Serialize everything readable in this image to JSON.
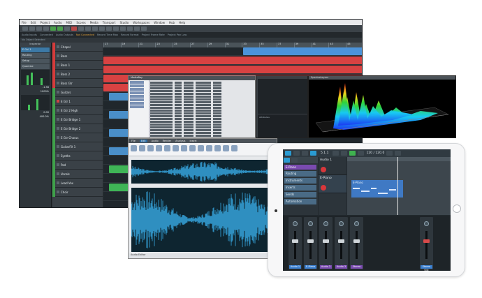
{
  "daw": {
    "menu": [
      "File",
      "Edit",
      "Project",
      "Audio",
      "MIDI",
      "Scores",
      "Media",
      "Transport",
      "Studio",
      "Workspaces",
      "Window",
      "Hub",
      "Help"
    ],
    "status": {
      "audio_inputs": "Audio Inputs",
      "connected": "Connected",
      "audio_outputs": "Audio Outputs",
      "not_connected": "Not Connected",
      "record_time": "Record Time Max",
      "record_format": "Record Format",
      "frame_rate": "Project Frame Rate",
      "pan_law": "Project Pan Law"
    },
    "info_line": "No Object Selected",
    "inspector_title": "Inspector",
    "inspector_rows": [
      "E Gui 1",
      "Routing",
      "Setup",
      "Quantize"
    ],
    "inspector_values": [
      "-1.58",
      "1000%",
      "0.00",
      "400.0%"
    ],
    "tracks": [
      {
        "name": "Chapel",
        "color": "#d43b3b"
      },
      {
        "name": "Bass",
        "color": "#d43b3b"
      },
      {
        "name": "Bass 1",
        "color": "#d43b3b"
      },
      {
        "name": "Bass 2",
        "color": "#d43b3b"
      },
      {
        "name": "Bass Gtr",
        "color": "#d43b3b"
      },
      {
        "name": "Guitars",
        "color": "#3fa04a"
      },
      {
        "name": "E Gtr 1",
        "color": "#3fa04a"
      },
      {
        "name": "E Gtr 2 High",
        "color": "#3fa04a"
      },
      {
        "name": "E Gtr Bridge 1",
        "color": "#3fa04a"
      },
      {
        "name": "E Gtr Bridge 2",
        "color": "#3fa04a"
      },
      {
        "name": "E Gtr Chorus",
        "color": "#3fa04a"
      },
      {
        "name": "GuitarFX 1",
        "color": "#3fa04a"
      },
      {
        "name": "Synths",
        "color": "#3fa04a"
      },
      {
        "name": "Pad",
        "color": "#3fa04a"
      },
      {
        "name": "Vocals",
        "color": "#3fa04a"
      },
      {
        "name": "Lead Vox",
        "color": "#3fa04a"
      },
      {
        "name": "Choir",
        "color": "#3fa04a"
      }
    ],
    "ruler": [
      "17",
      "19",
      "21",
      "23",
      "25",
      "27",
      "29",
      "31",
      "33",
      "35",
      "37",
      "39",
      "41",
      "43",
      "45"
    ]
  },
  "browser": {
    "title": "MediaBay"
  },
  "mediabay": {
    "info": "Attributes"
  },
  "spectrum": {
    "title": "SpectraLayers"
  },
  "wave": {
    "tabs": [
      "File",
      "Edit",
      "Audio",
      "Render",
      "Analysis",
      "Insert"
    ],
    "active_tab": "Edit",
    "status": "Audio Editor"
  },
  "ipad": {
    "position": "5.1.1",
    "bpm": "120 / 120.0",
    "track_name": "E-Piano",
    "categories": [
      "Routing",
      "Instruments",
      "Inserts",
      "Sends",
      "Automation"
    ],
    "tracks": [
      "Audio 1",
      "E-Piano"
    ],
    "midi_label": "E-Piano",
    "mixer": [
      {
        "name": "Audio 1",
        "color": "#3a7fd0"
      },
      {
        "name": "E-Piano",
        "color": "#3a7fd0"
      },
      {
        "name": "Audio 2",
        "color": "#7a4bb0"
      },
      {
        "name": "Audio 3",
        "color": "#7a4bb0"
      },
      {
        "name": "Stereo",
        "color": "#7a4bb0"
      }
    ],
    "master": {
      "name": "Stereo Out",
      "color": "#3a7fd0"
    }
  }
}
